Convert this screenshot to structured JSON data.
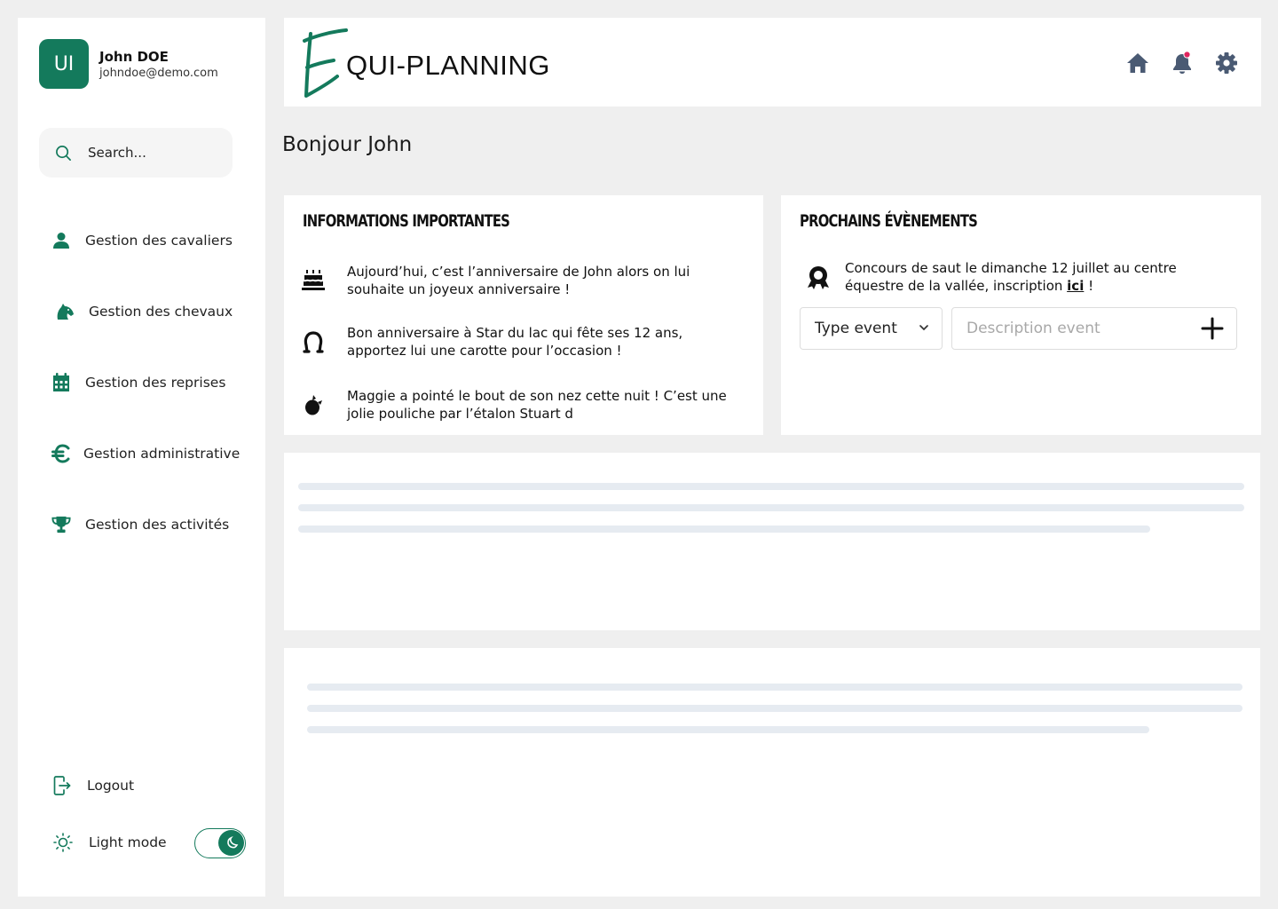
{
  "user": {
    "initials": "UI",
    "name": "John DOE",
    "email": "johndoe@demo.com"
  },
  "search": {
    "placeholder": "Search..."
  },
  "nav": [
    {
      "label": "Gestion des cavaliers",
      "icon": "user-icon"
    },
    {
      "label": "Gestion des chevaux",
      "icon": "horse-head-icon"
    },
    {
      "label": "Gestion des reprises",
      "icon": "calendar-icon"
    },
    {
      "label": "Gestion administrative",
      "icon": "euro-icon"
    },
    {
      "label": "Gestion des activités",
      "icon": "trophy-icon"
    }
  ],
  "bottom": {
    "logout_label": "Logout",
    "light_mode_label": "Light mode"
  },
  "header": {
    "logo_letter": "E",
    "logo_text": "QUI-PLANNING",
    "icons": [
      "home-icon",
      "bell-icon",
      "gear-icon"
    ]
  },
  "greeting": "Bonjour John",
  "infos": {
    "title": "Informations importantes",
    "items": [
      {
        "icon": "birthday-cake-icon",
        "line1": "Aujourd’hui, c’est l’anniversaire de John alors on lui",
        "line2": "souhaite un joyeux anniversaire !"
      },
      {
        "icon": "horseshoe-icon",
        "line1": "Bon anniversaire à Star du lac qui fête ses 12 ans,",
        "line2": "apportez lui une carotte pour l’occasion !"
      },
      {
        "icon": "foal-icon",
        "line1": "Maggie a pointé le bout de son nez cette nuit ! C’est une",
        "line2": "jolie pouliche par l’étalon Stuart d"
      }
    ]
  },
  "events": {
    "title": "Prochains évènements",
    "items": [
      {
        "icon": "award-icon",
        "line1": "Concours de saut le dimanche 12 juillet au centre",
        "line2": "équestre de la vallée, inscription ",
        "link": "ici",
        "suffix": " !"
      }
    ],
    "type_select": "Type event",
    "description_placeholder": "Description event"
  },
  "colors": {
    "brand": "#147a5c",
    "header_icons": "#4a5a73",
    "notification_dot": "#e0245e",
    "background": "#efefef",
    "skeleton": "#e6ebf1"
  }
}
